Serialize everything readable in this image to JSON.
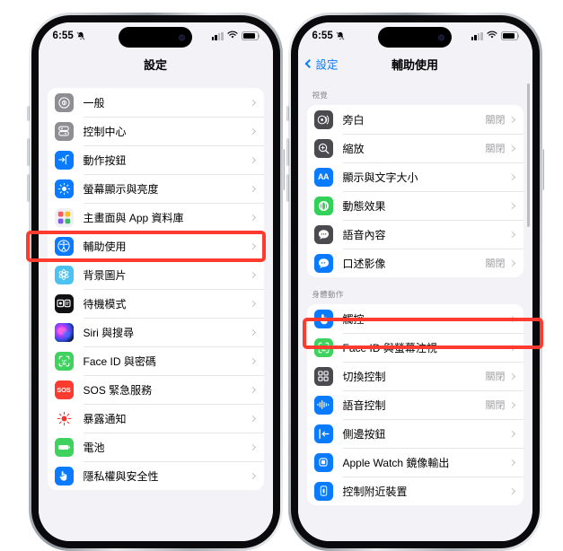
{
  "accent": {
    "ios_blue": "#0a7aff",
    "highlight_red": "#ff3b30",
    "value_gray": "#a0a0a5"
  },
  "status_bar": {
    "time": "6:55",
    "bell_icon": "bell-slash-icon",
    "cellular_icon": "cellular-bars-icon",
    "wifi_icon": "wifi-icon",
    "battery_icon": "battery-icon"
  },
  "left_phone": {
    "nav": {
      "title": "設定"
    },
    "rows": [
      {
        "label": "一般",
        "icon": "gear-icon",
        "value": ""
      },
      {
        "label": "控制中心",
        "icon": "control-center-icon",
        "value": ""
      },
      {
        "label": "動作按鈕",
        "icon": "action-button-icon",
        "value": ""
      },
      {
        "label": "螢幕顯示與亮度",
        "icon": "brightness-icon",
        "value": ""
      },
      {
        "label": "主畫面與 App 資料庫",
        "icon": "app-library-icon",
        "value": ""
      },
      {
        "label": "輔助使用",
        "icon": "accessibility-icon",
        "value": ""
      },
      {
        "label": "背景圖片",
        "icon": "wallpaper-icon",
        "value": ""
      },
      {
        "label": "待機模式",
        "icon": "standby-icon",
        "value": ""
      },
      {
        "label": "Siri 與搜尋",
        "icon": "siri-icon",
        "value": ""
      },
      {
        "label": "Face ID 與密碼",
        "icon": "faceid-icon",
        "value": ""
      },
      {
        "label": "SOS 緊急服務",
        "icon": "sos-icon",
        "value": ""
      },
      {
        "label": "暴露通知",
        "icon": "exposure-icon",
        "value": ""
      },
      {
        "label": "電池",
        "icon": "battery-green-icon",
        "value": ""
      },
      {
        "label": "隱私權與安全性",
        "icon": "privacy-hand-icon",
        "value": ""
      }
    ],
    "highlighted_row": "輔助使用"
  },
  "right_phone": {
    "nav": {
      "back_label": "設定",
      "title": "輔助使用"
    },
    "sections": [
      {
        "header": "視覺",
        "rows": [
          {
            "label": "旁白",
            "icon": "voiceover-icon",
            "value": "關閉"
          },
          {
            "label": "縮放",
            "icon": "zoom-icon",
            "value": "關閉"
          },
          {
            "label": "顯示與文字大小",
            "icon": "display-text-icon",
            "value": ""
          },
          {
            "label": "動態效果",
            "icon": "motion-icon",
            "value": ""
          },
          {
            "label": "語音內容",
            "icon": "spoken-content-icon",
            "value": ""
          },
          {
            "label": "口述影像",
            "icon": "audio-desc-icon",
            "value": "關閉"
          }
        ]
      },
      {
        "header": "身體動作",
        "rows": [
          {
            "label": "觸控",
            "icon": "touch-icon",
            "value": ""
          },
          {
            "label": "Face ID 與螢幕注視",
            "icon": "faceid-attention-icon",
            "value": ""
          },
          {
            "label": "切換控制",
            "icon": "switch-control-icon",
            "value": "關閉"
          },
          {
            "label": "語音控制",
            "icon": "voice-control-icon",
            "value": "關閉"
          },
          {
            "label": "側邊按鈕",
            "icon": "side-button-icon",
            "value": ""
          },
          {
            "label": "Apple Watch 鏡像輸出",
            "icon": "apple-watch-icon",
            "value": ""
          },
          {
            "label": "控制附近裝置",
            "icon": "nearby-devices-icon",
            "value": ""
          }
        ]
      }
    ],
    "highlighted_row": "觸控"
  }
}
